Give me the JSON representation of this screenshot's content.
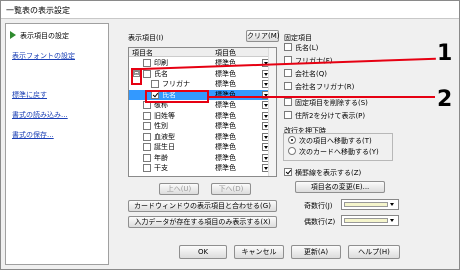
{
  "title": "一覧表の表示設定",
  "sidebar": {
    "items": [
      {
        "label": "表示項目の設定",
        "active": true
      },
      {
        "label": "表示フォントの設定"
      },
      {
        "label": "標準に戻す"
      },
      {
        "label": "書式の読み込み..."
      },
      {
        "label": "書式の保存..."
      }
    ]
  },
  "main": {
    "items_label": "表示項目(I)",
    "clear_button": "クリア(M)",
    "col_item": "項目名",
    "col_color": "項目色",
    "rows": [
      {
        "name": "印刷",
        "color": "標準色",
        "checked": false
      },
      {
        "name": "氏名",
        "color": "標準色",
        "checked": false,
        "expand": "⊟"
      },
      {
        "name": "フリガナ",
        "color": "標準色",
        "checked": false
      },
      {
        "name": "氏名",
        "color": "標準色",
        "checked": true,
        "selected": true
      },
      {
        "name": "敬称",
        "color": "標準色",
        "checked": false
      },
      {
        "name": "旧姓等",
        "color": "標準色",
        "checked": false
      },
      {
        "name": "性別",
        "color": "標準色",
        "checked": false
      },
      {
        "name": "血液型",
        "color": "標準色",
        "checked": false
      },
      {
        "name": "誕生日",
        "color": "標準色",
        "checked": false
      },
      {
        "name": "年齢",
        "color": "標準色",
        "checked": false
      },
      {
        "name": "干支",
        "color": "標準色",
        "checked": false
      }
    ],
    "up_button": "上へ(U)",
    "down_button": "下へ(D)",
    "card_window_button": "カードウィンドウの表示項目と合わせる(G)",
    "input_only_button": "入力データが存在する項目のみ表示する(X)"
  },
  "fixed": {
    "label": "固定項目",
    "items": [
      {
        "label": "氏名(L)",
        "checked": false
      },
      {
        "label": "フリガナ(F)",
        "checked": false
      },
      {
        "label": "会社名(Q)",
        "checked": false
      },
      {
        "label": "会社名フリガナ(R)",
        "checked": false
      },
      {
        "label": "固定項目を削除する(S)",
        "checked": false
      },
      {
        "label": "住所2を分けて表示(P)",
        "checked": false
      }
    ],
    "line_label": "改行を押下時",
    "radios": [
      {
        "label": "次の項目へ移動する(T)",
        "checked": true
      },
      {
        "label": "次のカードへ移動する(Y)",
        "checked": false
      }
    ],
    "grid_label": "横罫線を表示する(Z)",
    "rename_button": "項目名の変更(E)...",
    "odd_label": "奇数行(J)",
    "even_label": "偶数行(Z)"
  },
  "footer": {
    "ok": "OK",
    "cancel": "キャンセル",
    "apply": "更新(A)",
    "help": "ヘルプ(H)"
  },
  "callouts": [
    "1",
    "2"
  ],
  "colors": {
    "callout": "#e60012",
    "selection": "#3399ff",
    "link": "#1a3fb5"
  }
}
